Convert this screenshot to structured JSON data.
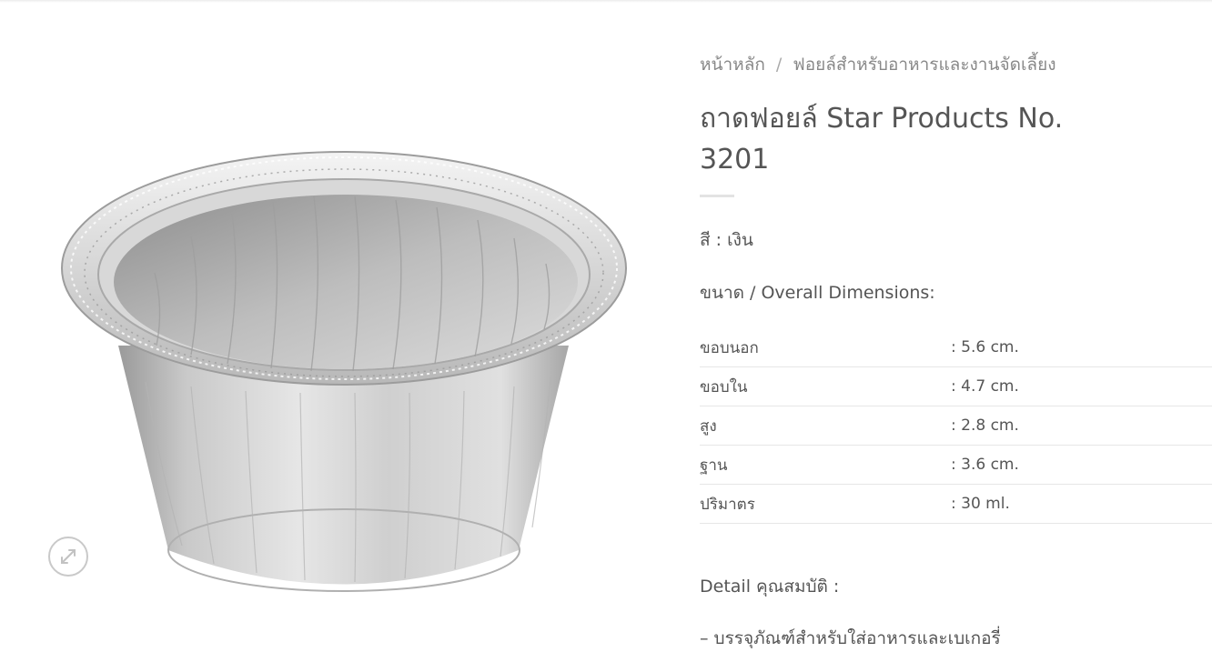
{
  "breadcrumb": {
    "home": "หน้าหลัก",
    "separator": "/",
    "category": "ฟอยล์สำหรับอาหารและงานจัดเลี้ยง"
  },
  "product": {
    "title": "ถาดฟอยล์ Star Products No. 3201",
    "color_line": "สี : เงิน",
    "dimensions_heading": "ขนาด / Overall Dimensions:",
    "specs": [
      {
        "label": "ขอบนอก",
        "value": ": 5.6 cm."
      },
      {
        "label": "ขอบใน",
        "value": ": 4.7 cm."
      },
      {
        "label": "สูง",
        "value": ": 2.8 cm."
      },
      {
        "label": "ฐาน",
        "value": ": 3.6 cm."
      },
      {
        "label": "ปริมาตร",
        "value": ": 30 ml."
      }
    ],
    "detail_heading": "Detail คุณสมบัติ :",
    "detail_items": [
      "– บรรจุภัณฑ์สำหรับใส่อาหารและเบเกอรี่"
    ]
  },
  "gallery": {
    "image_icon": "aluminum-foil-cup-image",
    "zoom_icon": "expand-arrows-icon"
  },
  "colors": {
    "text": "#555555",
    "muted": "#888888",
    "divider": "#e6e6e6"
  }
}
